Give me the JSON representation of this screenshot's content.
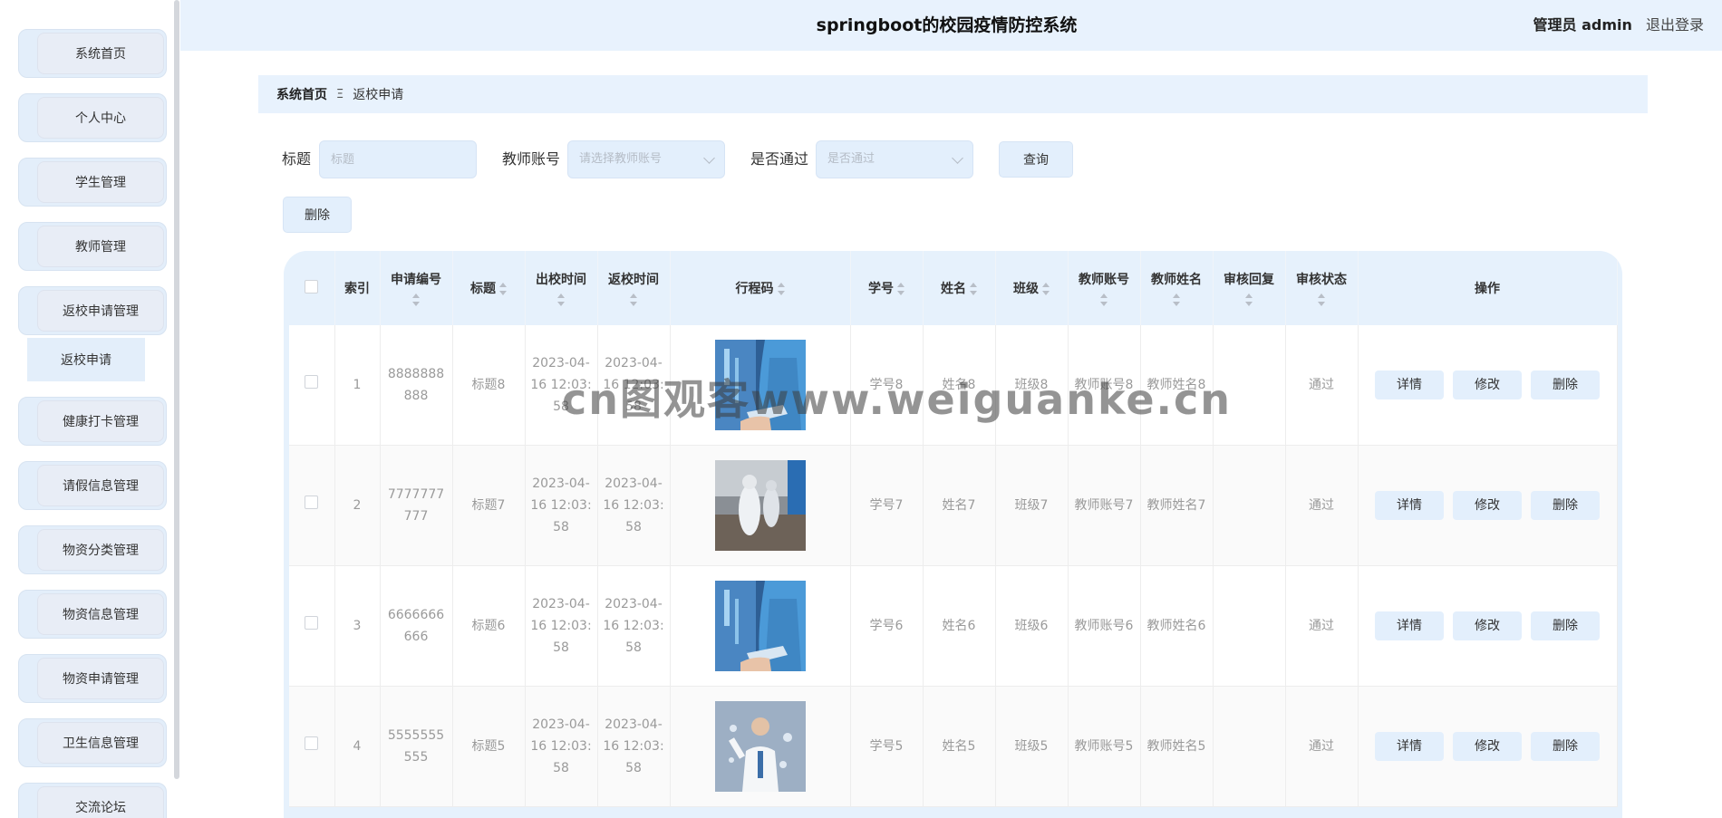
{
  "header": {
    "title": "springboot的校园疫情防控系统",
    "user_role": "管理员 admin",
    "logout": "退出登录"
  },
  "sidebar": {
    "items": [
      {
        "label": "系统首页"
      },
      {
        "label": "个人中心"
      },
      {
        "label": "学生管理"
      },
      {
        "label": "教师管理"
      },
      {
        "label": "返校申请管理"
      },
      {
        "label": "健康打卡管理"
      },
      {
        "label": "请假信息管理"
      },
      {
        "label": "物资分类管理"
      },
      {
        "label": "物资信息管理"
      },
      {
        "label": "物资申请管理"
      },
      {
        "label": "卫生信息管理"
      },
      {
        "label": "交流论坛"
      }
    ],
    "submenu": {
      "label": "返校申请"
    }
  },
  "breadcrumb": {
    "home": "系统首页",
    "separator": "Ξ",
    "current": "返校申请"
  },
  "search": {
    "title_label": "标题",
    "title_placeholder": "标题",
    "teacher_label": "教师账号",
    "teacher_placeholder": "请选择教师账号",
    "passed_label": "是否通过",
    "passed_placeholder": "是否通过",
    "query_button": "查询",
    "delete_button": "删除"
  },
  "table": {
    "columns": {
      "index": "索引",
      "app_no": "申请编号",
      "title": "标题",
      "leave_time": "出校时间",
      "return_time": "返校时间",
      "trip_code": "行程码",
      "student_no": "学号",
      "name": "姓名",
      "class": "班级",
      "teacher_account": "教师账号",
      "teacher_name": "教师姓名",
      "review_reply": "审核回复",
      "review_status": "审核状态",
      "actions": "操作"
    },
    "actions": {
      "detail": "详情",
      "edit": "修改",
      "delete": "删除"
    },
    "rows": [
      {
        "index": "1",
        "app_no": "8888888888",
        "title": "标题8",
        "leave_time": "2023-04-16 12:03:58",
        "return_time": "2023-04-16 12:03:58",
        "image": "medical-tablet",
        "student_no": "学号8",
        "name": "姓名8",
        "class": "班级8",
        "teacher_account": "教师账号8",
        "teacher_name": "教师姓名8",
        "review_reply": "",
        "review_status": "通过"
      },
      {
        "index": "2",
        "app_no": "7777777777",
        "title": "标题7",
        "leave_time": "2023-04-16 12:03:58",
        "return_time": "2023-04-16 12:03:58",
        "image": "hazmat-workers",
        "student_no": "学号7",
        "name": "姓名7",
        "class": "班级7",
        "teacher_account": "教师账号7",
        "teacher_name": "教师姓名7",
        "review_reply": "",
        "review_status": "通过"
      },
      {
        "index": "3",
        "app_no": "6666666666",
        "title": "标题6",
        "leave_time": "2023-04-16 12:03:58",
        "return_time": "2023-04-16 12:03:58",
        "image": "medical-tablet",
        "student_no": "学号6",
        "name": "姓名6",
        "class": "班级6",
        "teacher_account": "教师账号6",
        "teacher_name": "教师姓名6",
        "review_reply": "",
        "review_status": "通过"
      },
      {
        "index": "4",
        "app_no": "5555555555",
        "title": "标题5",
        "leave_time": "2023-04-16 12:03:58",
        "return_time": "2023-04-16 12:03:58",
        "image": "doctor-pointing",
        "student_no": "学号5",
        "name": "姓名5",
        "class": "班级5",
        "teacher_account": "教师账号5",
        "teacher_name": "教师姓名5",
        "review_reply": "",
        "review_status": "通过"
      }
    ]
  },
  "watermark": "cn图观客www.weiguanke.cn"
}
